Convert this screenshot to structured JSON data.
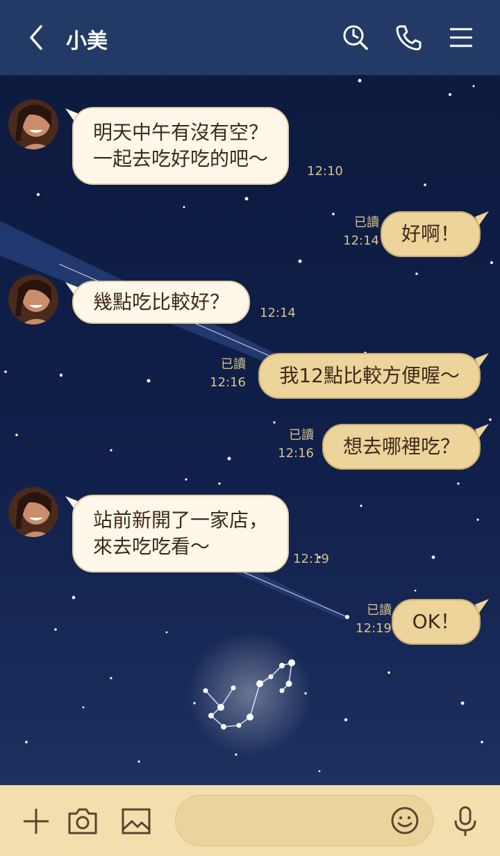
{
  "header": {
    "title": "小美",
    "icons": [
      "back-chevron-icon",
      "search-history-icon",
      "phone-icon",
      "menu-icon"
    ],
    "background": "#243a66"
  },
  "messages": [
    {
      "side": "in",
      "text": "明天中午有沒有空？\n一起去吃好吃的吧～",
      "time": "12:10"
    },
    {
      "side": "out",
      "text": "好啊！",
      "read": "已讀",
      "time": "12:14"
    },
    {
      "side": "in",
      "text": "幾點吃比較好？",
      "time": "12:14"
    },
    {
      "side": "out",
      "text": "我12點比較方便喔～",
      "read": "已讀",
      "time": "12:16"
    },
    {
      "side": "out",
      "text": "想去哪裡吃？",
      "read": "已讀",
      "time": "12:16"
    },
    {
      "side": "in",
      "text": "站前新開了一家店，\n來去吃吃看～",
      "time": "12:19"
    },
    {
      "side": "out",
      "text": "OK！",
      "read": "已讀",
      "time": "12:19"
    }
  ],
  "footer": {
    "icons": [
      "plus-icon",
      "camera-icon",
      "image-icon",
      "smile-icon",
      "microphone-icon"
    ],
    "input_value": "",
    "input_placeholder": ""
  },
  "colors": {
    "incoming_bubble": "#fff8ea",
    "outgoing_bubble": "#ecd49a",
    "meta_text": "#d9c28a",
    "footer": "#f2dfad"
  }
}
